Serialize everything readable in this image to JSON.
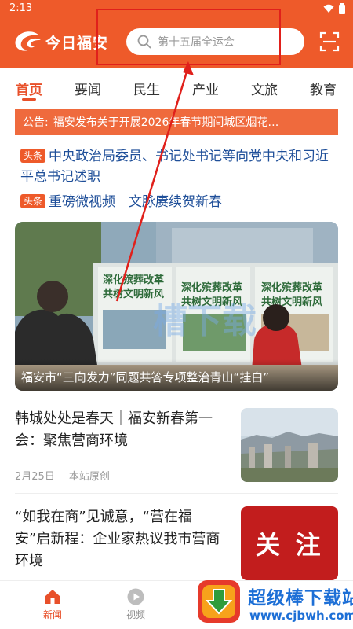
{
  "status_bar": {
    "time": "2:13"
  },
  "header": {
    "app_name": "今日福安",
    "search_placeholder": "第十五届全运会"
  },
  "tabs": [
    "首页",
    "要闻",
    "民生",
    "产业",
    "文旅",
    "教育"
  ],
  "notice": {
    "label": "公告:",
    "text": "福安发布关于开展2026年春节期间城区烟花…"
  },
  "headlines": [
    {
      "badge": "头条",
      "text": "中央政治局委员、书记处书记等向党中央和习近平总书记述职"
    },
    {
      "badge": "头条",
      "text": "重磅微视频｜文脉赓续贺新春"
    }
  ],
  "hero": {
    "caption": "福安市“三向发力”同题共答专项整治青山“挂白”",
    "board_texts": [
      "深化殡葬改革",
      "共树文明新风",
      "深化殡葬改革",
      "共树文明新风",
      "深化殡葬改革",
      "共树文明新风"
    ]
  },
  "articles": [
    {
      "title": "韩城处处是春天｜福安新春第一会：聚焦营商环境",
      "date": "2月25日",
      "source": "本站原创"
    },
    {
      "title": "“如我在商”见诚意，“营在福安”启新程：企业家热议我市营商环境",
      "thumb_text": "关 注"
    }
  ],
  "bottom_nav": [
    {
      "label": "新闻",
      "icon": "home-icon"
    },
    {
      "label": "视频",
      "icon": "play-icon"
    }
  ],
  "watermark": {
    "name": "超级棒下载站",
    "url": "www.cjbwh.com",
    "overlay": "槽下载"
  },
  "colors": {
    "brand_orange": "#ee5a2a",
    "headline_blue": "#1f4f99",
    "annotation_red": "#e0201b"
  }
}
